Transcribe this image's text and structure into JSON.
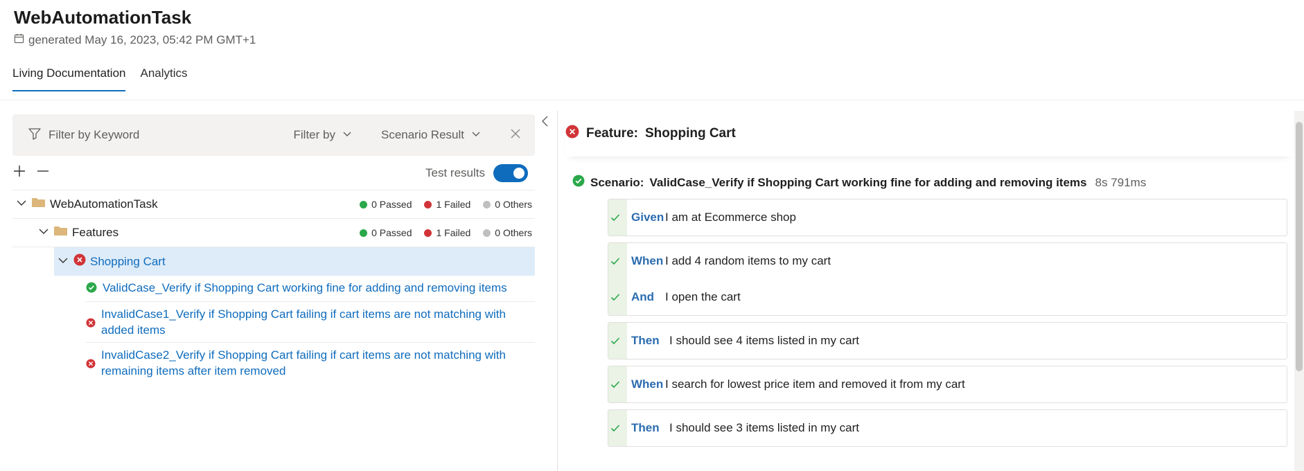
{
  "app": {
    "title": "WebAutomationTask",
    "generated": "generated May 16, 2023, 05:42 PM GMT+1"
  },
  "tabs": [
    {
      "label": "Living Documentation",
      "active": true
    },
    {
      "label": "Analytics",
      "active": false
    }
  ],
  "filter": {
    "placeholder": "Filter by Keyword",
    "filter_by": "Filter by",
    "scenario_result": "Scenario Result"
  },
  "toolbar": {
    "test_results_label": "Test results",
    "test_results_on": true
  },
  "tree": {
    "root": {
      "label": "WebAutomationTask",
      "passed": "0 Passed",
      "failed": "1 Failed",
      "others": "0 Others"
    },
    "features": {
      "label": "Features",
      "passed": "0 Passed",
      "failed": "1 Failed",
      "others": "0 Others"
    },
    "feature": {
      "label": "Shopping Cart",
      "status": "failed"
    },
    "scenarios": [
      {
        "label": "ValidCase_Verify if Shopping Cart working fine for adding and removing items",
        "status": "passed"
      },
      {
        "label": "InvalidCase1_Verify if Shopping Cart failing if cart items are not matching with added items",
        "status": "failed"
      },
      {
        "label": "InvalidCase2_Verify if Shopping Cart failing if cart items are not matching with remaining items after item removed",
        "status": "failed"
      }
    ]
  },
  "detail": {
    "feature_prefix": "Feature:",
    "feature_name": "Shopping Cart",
    "scenario_prefix": "Scenario:",
    "scenario_name": "ValidCase_Verify if Shopping Cart working fine for adding and removing items",
    "duration": "8s 791ms",
    "step_groups": [
      [
        {
          "keyword": "Given",
          "text": "I am at Ecommerce shop"
        }
      ],
      [
        {
          "keyword": "When",
          "text": "I add 4 random items to my cart"
        },
        {
          "keyword": "And",
          "text": "I open the cart"
        }
      ],
      [
        {
          "keyword": "Then",
          "text": "I should see 4 items listed in my cart"
        }
      ],
      [
        {
          "keyword": "When",
          "text": "I search for lowest price item and removed it from my cart"
        }
      ],
      [
        {
          "keyword": "Then",
          "text": "I should see 3 items listed in my cart"
        }
      ]
    ]
  },
  "colors": {
    "passed": "#2aa84a",
    "failed": "#d13438",
    "others": "#bfbfbf",
    "accent": "#0f6cbd"
  },
  "icons": [
    "calendar-icon",
    "filter-icon",
    "chevron-down-icon",
    "close-icon",
    "plus-icon",
    "minus-icon",
    "folder-icon",
    "failed-icon",
    "passed-icon",
    "check-icon",
    "chevron-left-icon"
  ]
}
